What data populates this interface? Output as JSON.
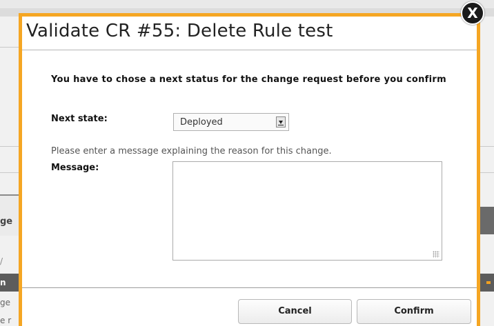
{
  "background": {
    "fragment_texts": [
      "ge",
      "/",
      "n",
      "ge",
      "e r"
    ]
  },
  "modal": {
    "title": "Validate CR #55: Delete Rule test",
    "intro": "You have to chose a next status for the change request before you confirm",
    "next_state_label": "Next state:",
    "next_state_value": "Deployed",
    "hint": "Please enter a message explaining the reason for this change.",
    "message_label": "Message:",
    "message_value": "",
    "cancel_label": "Cancel",
    "confirm_label": "Confirm",
    "close_glyph": "X"
  },
  "colors": {
    "modal_border": "#f5a623",
    "close_button": "#1a1a1a"
  }
}
